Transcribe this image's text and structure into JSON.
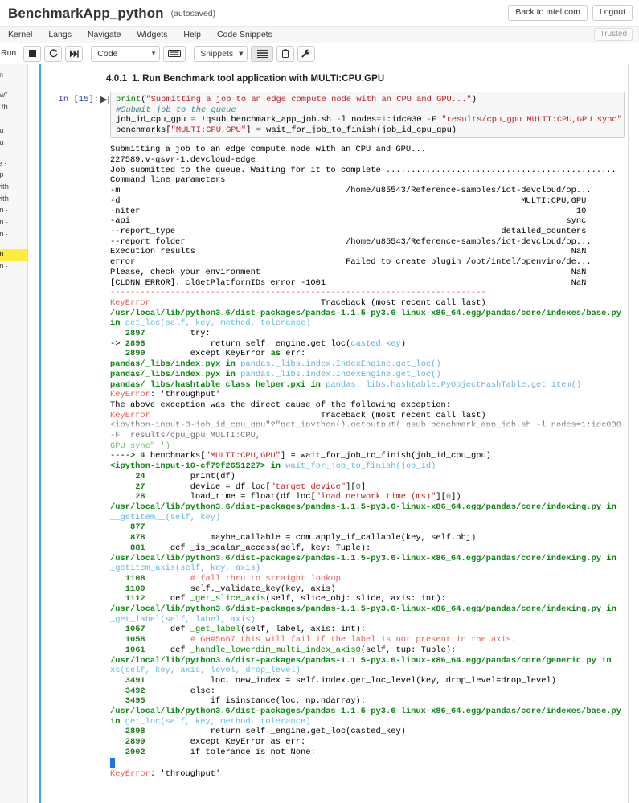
{
  "header": {
    "notebook_title": "BenchmarkApp_python",
    "autosaved": "(autosaved)",
    "back_button": "Back to Intel.com",
    "logout_button": "Logout"
  },
  "menubar": {
    "items": [
      "Kernel",
      "Langs",
      "Navigate",
      "Widgets",
      "Help",
      "Code Snippets"
    ],
    "trusted_badge": "Trusted"
  },
  "toolbar": {
    "run_label": "Run",
    "stop_icon": "stop-square-icon",
    "restart_icon": "restart-circular-arrow-icon",
    "restart_run_all_icon": "fast-forward-icon",
    "cell_type": "Code",
    "cell_type_caret": "chevron-down-icon",
    "keyboard_icon": "keyboard-icon",
    "snippets_label": "Snippets",
    "snippets_caret": "chevron-down-icon",
    "toc_icon": "list-lines-icon",
    "clipboard_icon": "clipboard-icon",
    "wrench_icon": "wrench-icon"
  },
  "toc_sidebar": {
    "lines": [
      "im",
      "",
      "ow\"",
      "g th",
      ";",
      "qu",
      "qu",
      "",
      "re ·",
      "ep",
      "with",
      "with",
      "on ·",
      "on ·",
      "on ·",
      "",
      "on",
      "on ·"
    ],
    "highlighted_index": 16
  },
  "section": {
    "number": "4.0.1",
    "title": "1. Run Benchmark tool application with MULTI:CPU,GPU"
  },
  "cell": {
    "prompt": "In [15]:",
    "run_glyph": "play-icon",
    "code_lines": [
      "print(\"Submitting a job to an edge compute node with an CPU and GPU...\")",
      "#Submit job to the queue",
      "job_id_cpu_gpu = !qsub benchmark_app_job.sh -l nodes=1:idc030 -F \"results/cpu_gpu MULTI:CPU,GPU sync\"",
      "benchmarks[\"MULTI:CPU,GPU\"] = wait_for_job_to_finish(job_id_cpu_gpu)"
    ]
  },
  "output": {
    "stdout": [
      "Submitting a job to an edge compute node with an CPU and GPU...",
      "227589.v-qsvr-1.devcloud-edge",
      "Job submitted to the queue. Waiting for it to complete ..............................................",
      "Command line parameters"
    ],
    "params_table": [
      {
        "key": "-m",
        "value": "/home/u85543/Reference-samples/iot-devcloud/op..."
      },
      {
        "key": "-d",
        "value": "MULTI:CPU,GPU"
      },
      {
        "key": "-niter",
        "value": "10"
      },
      {
        "key": "-api",
        "value": "sync"
      },
      {
        "key": "--report_type",
        "value": "detailed_counters"
      },
      {
        "key": "--report_folder",
        "value": "/home/u85543/Reference-samples/iot-devcloud/op..."
      },
      {
        "key": "Execution results",
        "value": "NaN"
      },
      {
        "key": "error",
        "value": "Failed to create plugin /opt/intel/openvino/de..."
      },
      {
        "key": "Please, check your environment",
        "value": "NaN"
      },
      {
        "key": "[CLDNN ERROR]. clGetPlatformIDs error -1001",
        "value": "NaN"
      }
    ],
    "separator": "---------------------------------------------------------------------------",
    "traceback_header_error": "KeyError",
    "traceback_header_text": "Traceback (most recent call last)",
    "frames": [
      {
        "path": "/usr/local/lib/python3.6/dist-packages/pandas-1.1.5-py3.6-linux-x86_64.egg/pandas/core/indexes/base.py",
        "in": "in",
        "func": "get_loc(self, key, method, tolerance)",
        "lines": [
          {
            "no": "2897",
            "arrow": "",
            "code": "        try:"
          },
          {
            "no": "2898",
            "arrow": "-> ",
            "code": "            return self._engine.get_loc(casted_key)"
          },
          {
            "no": "2899",
            "arrow": "",
            "code": "        except KeyError as err:"
          }
        ]
      }
    ],
    "pyx_frames": [
      {
        "file": "pandas/_libs/index.pyx",
        "in": "in",
        "func": "pandas._libs.index.IndexEngine.get_loc()"
      },
      {
        "file": "pandas/_libs/index.pyx",
        "in": "in",
        "func": "pandas._libs.index.IndexEngine.get_loc()"
      },
      {
        "file": "pandas/_libs/hashtable_class_helper.pxi",
        "in": "in",
        "func": "pandas._libs.hashtable.PyObjectHashTable.get_item()"
      }
    ],
    "keyerror_1_name": "KeyError",
    "keyerror_1_msg": ": 'throughput'",
    "chained_note": "The above exception was the direct cause of the following exception:",
    "traceback2_error": "KeyError",
    "traceback2_text": "Traceback (most recent call last)",
    "ghost_line_1": "<ipython-input-3-job_id_cpu_gpu\"?\"get_ipython().getoutput( qsub benchmark_app_job.sh -l nodes=1:idc030 -F  results/cpu_gpu MULTI:CPU,",
    "ghost_line_2": "GPU sync\" ')",
    "cell_frame_arrow": "----> 4 ",
    "cell_frame_code": "benchmarks[\"MULTI:CPU,GPU\"] = wait_for_job_to_finish(job_id_cpu_gpu)",
    "ipython_frame": {
      "file": "<ipython-input-10-cf79f2651227>",
      "in": "in",
      "func": "wait_for_job_to_finish(job_id)",
      "lines": [
        {
          "no": "24",
          "code": "        print(df)"
        },
        {
          "no": "27",
          "code": "        device = df.loc[\"target device\"][0]"
        },
        {
          "no": "28",
          "code": "        load_time = float(df.loc[\"load network time (ms)\"][0])"
        }
      ]
    },
    "frames_2": [
      {
        "path": "/usr/local/lib/python3.6/dist-packages/pandas-1.1.5-py3.6-linux-x86_64.egg/pandas/core/indexing.py",
        "func": "__getitem__(self, key)",
        "lines": [
          {
            "no": "877",
            "code": ""
          },
          {
            "no": "878",
            "code": "            maybe_callable = com.apply_if_callable(key, self.obj)"
          },
          {
            "no": "881",
            "code": "    def _is_scalar_access(self, key: Tuple):"
          }
        ]
      },
      {
        "path": "/usr/local/lib/python3.6/dist-packages/pandas-1.1.5-py3.6-linux-x86_64.egg/pandas/core/indexing.py",
        "func": "_getitem_axis(self, key, axis)",
        "lines": [
          {
            "no": "1108",
            "code": "        # fall thru to straight lookup",
            "comment": true
          },
          {
            "no": "1109",
            "code": "        self._validate_key(key, axis)"
          },
          {
            "no": "1112",
            "code": "    def _get_slice_axis(self, slice_obj: slice, axis: int):"
          }
        ]
      },
      {
        "path": "/usr/local/lib/python3.6/dist-packages/pandas-1.1.5-py3.6-linux-x86_64.egg/pandas/core/indexing.py",
        "func": "_get_label(self, label, axis)",
        "lines": [
          {
            "no": "1057",
            "code": "    def _get_label(self, label, axis: int):"
          },
          {
            "no": "1058",
            "code": "        # GH#5667 this will fail if the label is not present in the axis.",
            "comment": true
          },
          {
            "no": "1061",
            "code": "    def _handle_lowerdim_multi_index_axis0(self, tup: Tuple):"
          }
        ]
      },
      {
        "path": "/usr/local/lib/python3.6/dist-packages/pandas-1.1.5-py3.6-linux-x86_64.egg/pandas/core/generic.py",
        "func": "xs(self, key, axis, level, drop_level)",
        "lines": [
          {
            "no": "3491",
            "code": "            loc, new_index = self.index.get_loc_level(key, drop_level=drop_level)"
          },
          {
            "no": "3492",
            "code": "        else:"
          },
          {
            "no": "3495",
            "code": "            if isinstance(loc, np.ndarray):"
          }
        ]
      },
      {
        "path": "/usr/local/lib/python3.6/dist-packages/pandas-1.1.5-py3.6-linux-x86_64.egg/pandas/core/indexes/base.py",
        "func": "get_loc(self, key, method, tolerance)",
        "lines": [
          {
            "no": "2898",
            "code": "            return self._engine.get_loc(casted_key)"
          },
          {
            "no": "2899",
            "code": "        except KeyError as err:"
          },
          {
            "no": "2902",
            "code": "        if tolerance is not None:"
          }
        ]
      }
    ],
    "final_error_name": "KeyError",
    "final_error_msg": ": 'throughput'"
  },
  "colors": {
    "accent_blue": "#42a5f5",
    "error_red": "#e75c58",
    "file_green": "#0e8a16",
    "func_cyan": "#5bc0de",
    "highlight_yellow": "#ffec3d"
  }
}
